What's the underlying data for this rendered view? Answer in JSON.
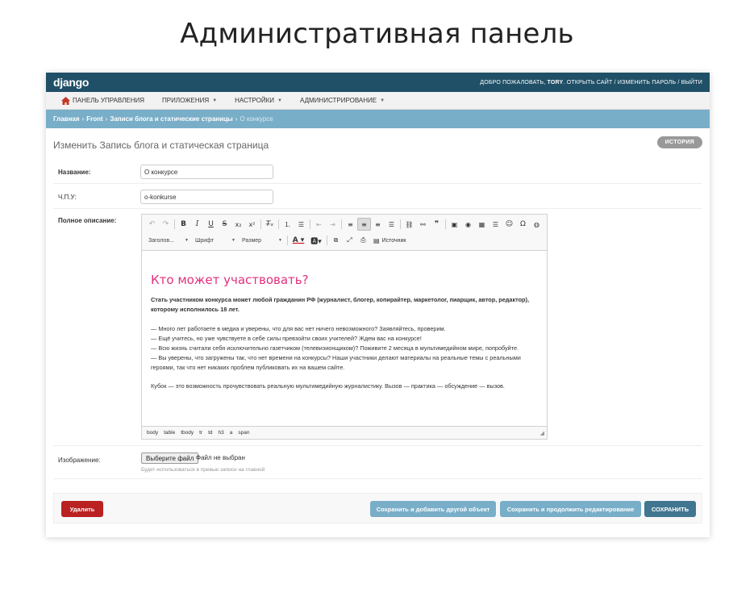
{
  "page_heading": "Административная панель",
  "header": {
    "brand": "django",
    "welcome": "ДОБРО ПОЖАЛОВАТЬ,",
    "username": "TORY",
    "links": [
      "ОТКРЫТЬ САЙТ",
      "ИЗМЕНИТЬ ПАРОЛЬ",
      "ВЫЙТИ"
    ]
  },
  "menu": {
    "items": [
      {
        "label": "ПАНЕЛЬ УПРАВЛЕНИЯ",
        "icon": "home-icon",
        "has_dropdown": false
      },
      {
        "label": "ПРИЛОЖЕНИЯ",
        "has_dropdown": true
      },
      {
        "label": "НАСТРОЙКИ",
        "has_dropdown": true
      },
      {
        "label": "АДМИНИСТРИРОВАНИЕ",
        "has_dropdown": true
      }
    ]
  },
  "breadcrumbs": [
    "Главная",
    "Front",
    "Записи блога и статические страницы",
    "О конкурсе"
  ],
  "content_title": "Изменить Запись блога и статическая страница",
  "history_label": "ИСТОРИЯ",
  "fields": {
    "name": {
      "label": "Название:",
      "value": "О конкурсе"
    },
    "slug": {
      "label": "Ч.П.У:",
      "value": "o-konkurse"
    },
    "description": {
      "label": "Полное описание:"
    },
    "image": {
      "label": "Изображение:",
      "button_label": "Выберите файл",
      "status": "Файл не выбран",
      "help": "Будет использоваться в превью записи на главной"
    }
  },
  "editor": {
    "combos": {
      "format": "Заголов...",
      "font": "Шрифт",
      "size": "Размер"
    },
    "source_label": "Источник",
    "content": {
      "heading": "Кто может участвовать?",
      "bold_paragraph": "Стать участником конкурса может любой гражданин РФ (журналист, блогер, копирайтер, маркетолог, пиарщик,  автор, редактор), которому исполнилось 18 лет.",
      "lines": [
        "— Много лет работаете в медиа и уверены, что для вас нет ничего невозможного? Заявляйтесь, проверим.",
        "— Ещё учитесь, но уже чувствуете в себе силы превзойти своих учителей? Ждем вас на конкурсе!",
        "— Всю жизнь считали себя исключительно газетчиком (телевизионщиком)? Поживите 2 месяца в мультимедийном мире, попробуйте.",
        "— Вы уверены, что загружены так, что нет времени на конкурсы? Наши участники делают материалы на реальные темы с реальными героями, так что нет никаких проблем публиковать их на вашем сайте."
      ],
      "closing": "Кубок — это возможность прочувствовать реальную мультимедийную журналистику. Вызов — практика — обсуждение — вызов."
    },
    "path": [
      "body",
      "table",
      "tbody",
      "tr",
      "td",
      "h3",
      "a",
      "span"
    ]
  },
  "actions": {
    "delete": "Удалить",
    "save_add_another": "Сохранить и добавить другой объект",
    "save_continue": "Сохранить и продолжить редактирование",
    "save": "СОХРАНИТЬ"
  },
  "colors": {
    "header_bg": "#205067",
    "breadcrumbs_bg": "#79aec8",
    "heading_pink": "#e32f7e",
    "delete_red": "#ba2121",
    "save_dark": "#417690"
  }
}
